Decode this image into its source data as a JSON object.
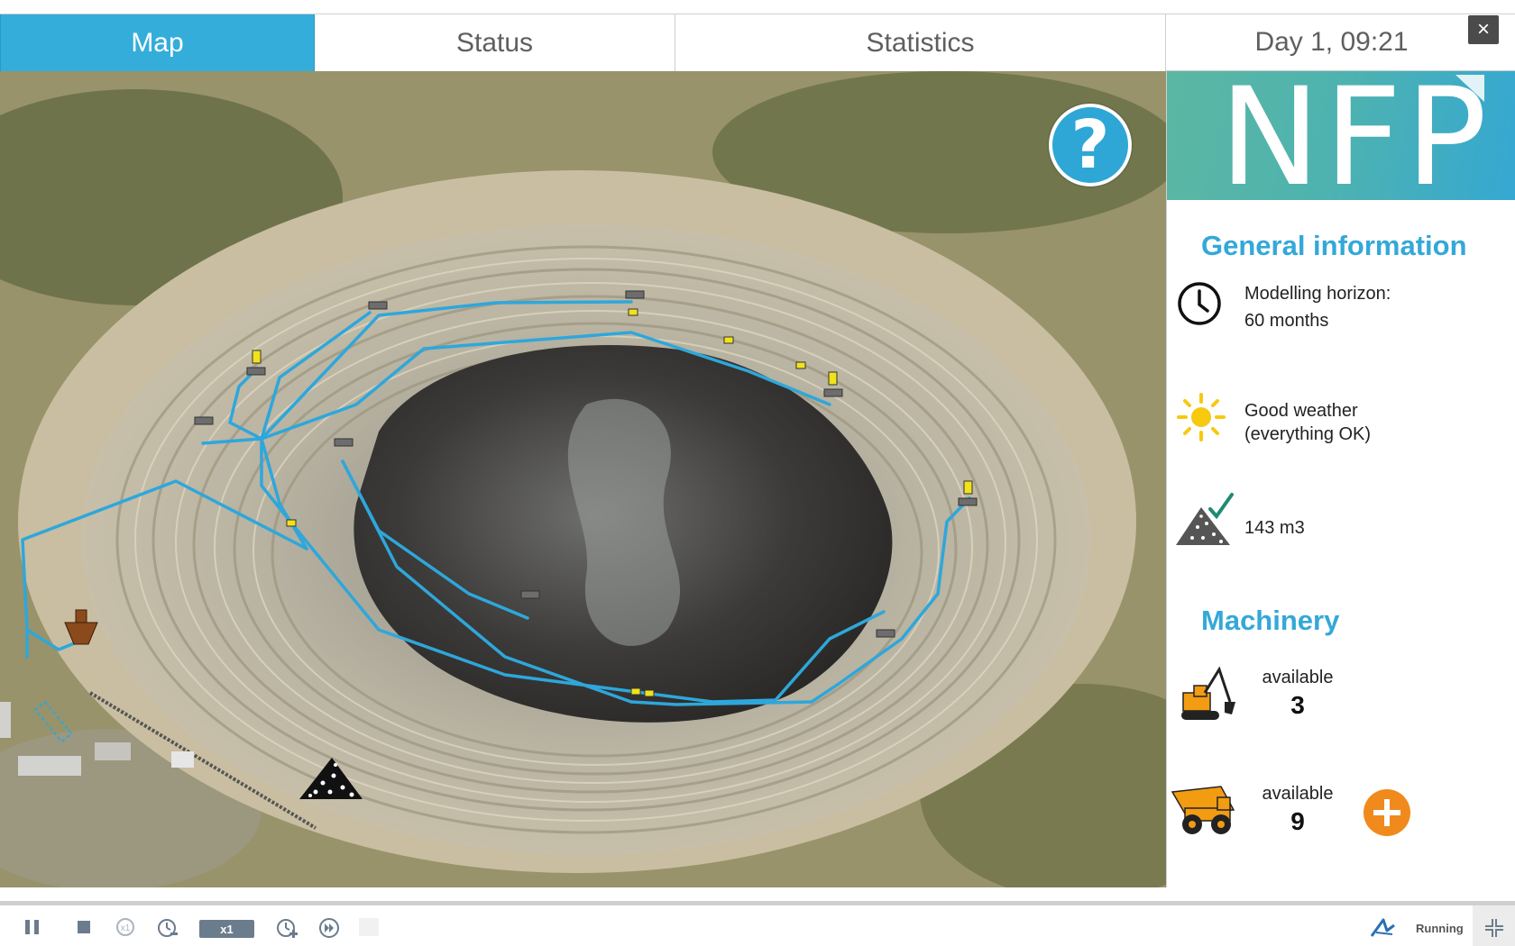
{
  "tabs": [
    {
      "label": "Map",
      "active": true
    },
    {
      "label": "Status",
      "active": false
    },
    {
      "label": "Statistics",
      "active": false
    }
  ],
  "clock": "Day 1, 09:21",
  "close_label": "×",
  "help_label": "?",
  "logo": "NFP",
  "general": {
    "title": "General information",
    "horizon_label": "Modelling horizon:",
    "horizon_value": "60 months",
    "weather_line1": "Good weather",
    "weather_line2": "(everything OK)",
    "stock": "143 m3"
  },
  "machinery": {
    "title": "Machinery",
    "excavators": {
      "label": "available",
      "count": "3"
    },
    "trucks": {
      "label": "available",
      "count": "9"
    }
  },
  "controls": {
    "speed": "x1",
    "status": "Running"
  },
  "colors": {
    "accent": "#34addb",
    "route": "#2ea7db",
    "add_button": "#f08a1c"
  }
}
